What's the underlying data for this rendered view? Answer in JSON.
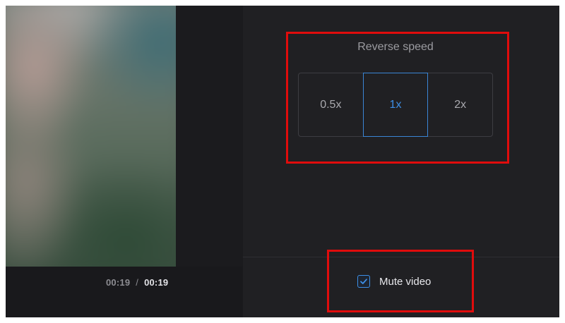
{
  "player": {
    "current_time": "00:19",
    "separator": "/",
    "total_time": "00:19"
  },
  "reverse_speed": {
    "title": "Reverse speed",
    "options": [
      {
        "label": "0.5x",
        "selected": false
      },
      {
        "label": "1x",
        "selected": true
      },
      {
        "label": "2x",
        "selected": false
      }
    ]
  },
  "mute": {
    "label": "Mute video",
    "checked": true,
    "icon": "check-icon"
  },
  "colors": {
    "accent": "#3d8fe6",
    "highlight": "#e00c0c",
    "panel": "#202023",
    "video_bg": "#19191c"
  }
}
